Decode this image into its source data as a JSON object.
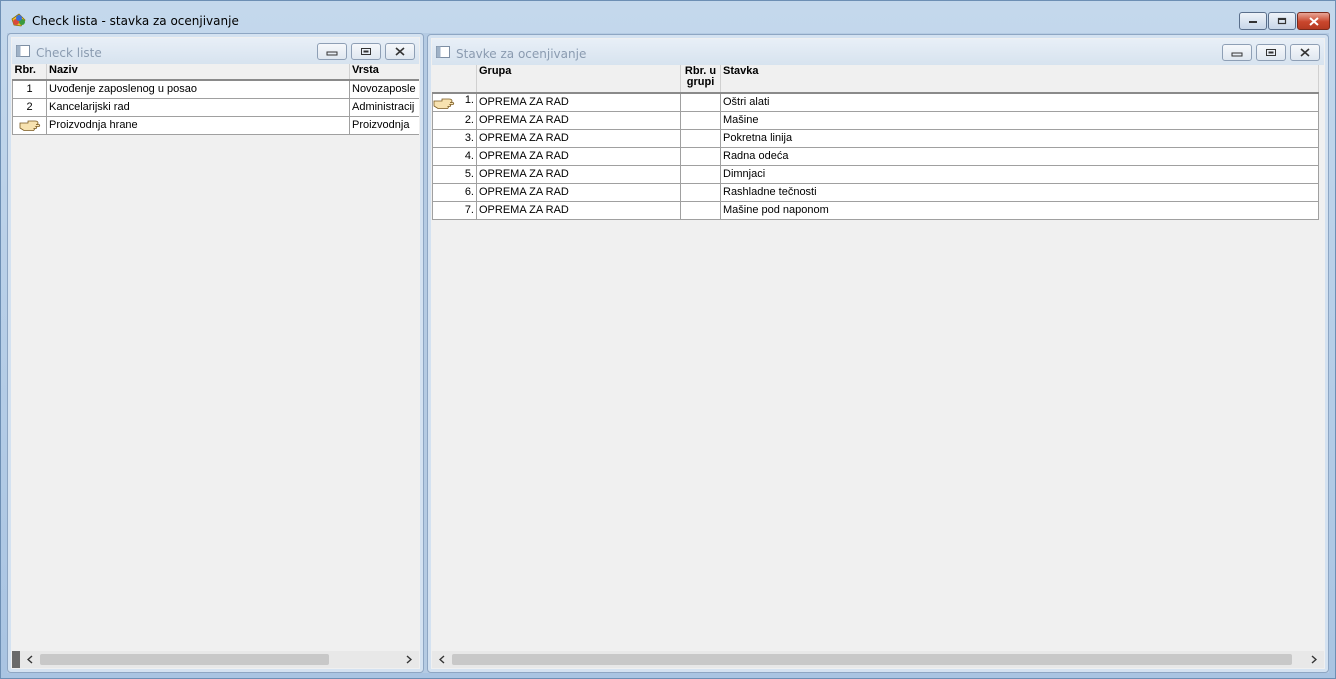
{
  "app": {
    "title": "Check lista - stavka za ocenjivanje"
  },
  "left_panel": {
    "title": "Check liste",
    "columns": [
      "Rbr.",
      "Naziv",
      "Vrsta"
    ],
    "rows": [
      {
        "rbr": "1",
        "naziv": "Uvođenje zaposlenog u posao",
        "vrsta": "Novozaposle"
      },
      {
        "rbr": "2",
        "naziv": "Kancelarijski rad",
        "vrsta": "Administracij"
      },
      {
        "rbr": "",
        "naziv": "Proizvodnja hrane",
        "vrsta": "Proizvodnja"
      }
    ]
  },
  "right_panel": {
    "title": "Stavke za ocenjivanje",
    "columns": [
      "",
      "Grupa",
      "Rbr. u grupi",
      "Stavka"
    ],
    "rows": [
      {
        "rbr": "1.",
        "grupa": "OPREMA ZA RAD",
        "rbr_grupa": "",
        "stavka": "Oštri alati"
      },
      {
        "rbr": "2.",
        "grupa": "OPREMA ZA RAD",
        "rbr_grupa": "",
        "stavka": "Mašine"
      },
      {
        "rbr": "3.",
        "grupa": "OPREMA ZA RAD",
        "rbr_grupa": "",
        "stavka": "Pokretna linija"
      },
      {
        "rbr": "4.",
        "grupa": "OPREMA ZA RAD",
        "rbr_grupa": "",
        "stavka": "Radna odeća"
      },
      {
        "rbr": "5.",
        "grupa": "OPREMA ZA RAD",
        "rbr_grupa": "",
        "stavka": "Dimnjaci"
      },
      {
        "rbr": "6.",
        "grupa": "OPREMA ZA RAD",
        "rbr_grupa": "",
        "stavka": "Rashladne tečnosti"
      },
      {
        "rbr": "7.",
        "grupa": "OPREMA ZA RAD",
        "rbr_grupa": "",
        "stavka": "Mašine pod naponom"
      }
    ]
  },
  "icons": {
    "pointer": "pointing-hand-icon",
    "scroll_left": "chevron-left-icon",
    "scroll_right": "chevron-right-icon"
  },
  "colors": {
    "close_button": "#c9462c",
    "window_frame": "#b9d1ea"
  }
}
